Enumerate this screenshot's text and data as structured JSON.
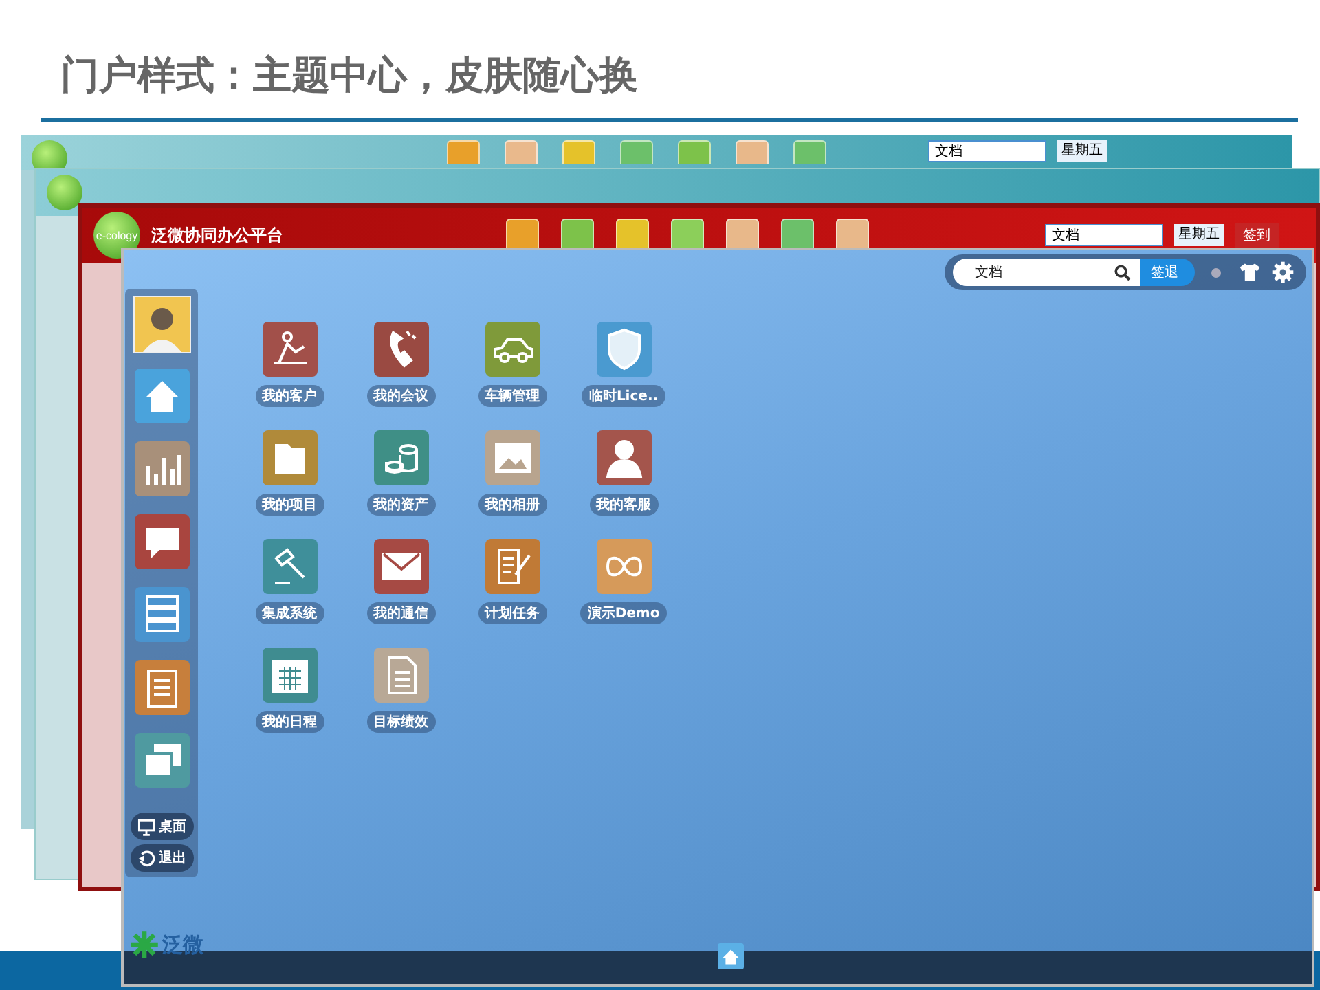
{
  "slide": {
    "title": "门户样式：主题中心，皮肤随心换"
  },
  "back_windows": [
    {
      "kind": "teal",
      "tiles": [
        {
          "color": "#e8a02a"
        },
        {
          "color": "#e9b98c"
        },
        {
          "color": "#e5c22a"
        },
        {
          "color": "#6cc06a"
        },
        {
          "color": "#7dc24a"
        },
        {
          "color": "#e8b88a"
        },
        {
          "color": "#6cc06a"
        }
      ],
      "search": "文档",
      "day": "星期五"
    },
    {
      "kind": "teal2"
    },
    {
      "kind": "red",
      "logo": "e-cology",
      "title": "泛微协同办公平台",
      "tiles": [
        {
          "color": "#e8a02a"
        },
        {
          "color": "#7dc24a"
        },
        {
          "color": "#e5c22a"
        },
        {
          "color": "#8ccf5a"
        },
        {
          "color": "#e8b88a"
        },
        {
          "color": "#6cc06a"
        },
        {
          "color": "#e8b88a"
        }
      ],
      "search": "文档",
      "day": "星期五",
      "sign": "签到"
    }
  ],
  "front_window": {
    "search": "文档",
    "sign_out": "签退",
    "sidebar": [
      {
        "kind": "home",
        "color": "#4aa3dc"
      },
      {
        "kind": "chart",
        "color": "#a8907a"
      },
      {
        "kind": "chat",
        "color": "#a9453f"
      },
      {
        "kind": "stack",
        "color": "#4a94cf"
      },
      {
        "kind": "clipboard",
        "color": "#c77f3c"
      },
      {
        "kind": "windows",
        "color": "#4f9aa0"
      }
    ],
    "dock_buttons": [
      {
        "kind": "desktop",
        "label": "桌面"
      },
      {
        "kind": "logout",
        "label": "退出"
      }
    ],
    "apps": [
      {
        "kind": "customer",
        "label": "我的客户",
        "color": "#a2504a"
      },
      {
        "kind": "phone",
        "label": "我的会议",
        "color": "#9a4a42"
      },
      {
        "kind": "car",
        "label": "车辆管理",
        "color": "#7f9a3a"
      },
      {
        "kind": "shield",
        "label": "临时Lice..",
        "color": "#4a9ad0"
      },
      {
        "kind": "folder",
        "label": "我的项目",
        "color": "#b08a3a"
      },
      {
        "kind": "coins",
        "label": "我的资产",
        "color": "#3f8f86"
      },
      {
        "kind": "picture",
        "label": "我的相册",
        "color": "#b8a48e"
      },
      {
        "kind": "person",
        "label": "我的客服",
        "color": "#a4554c"
      },
      {
        "kind": "gavel",
        "label": "集成系统",
        "color": "#3f8f9a"
      },
      {
        "kind": "envelope",
        "label": "我的通信",
        "color": "#a64a44"
      },
      {
        "kind": "edit",
        "label": "计划任务",
        "color": "#c07a36"
      },
      {
        "kind": "infinity",
        "label": "演示Demo",
        "color": "#d69a5a"
      },
      {
        "kind": "calendar",
        "label": "我的日程",
        "color": "#3f8c90"
      },
      {
        "kind": "document",
        "label": "目标绩效",
        "color": "#b8a896"
      }
    ],
    "logo": "泛微"
  }
}
